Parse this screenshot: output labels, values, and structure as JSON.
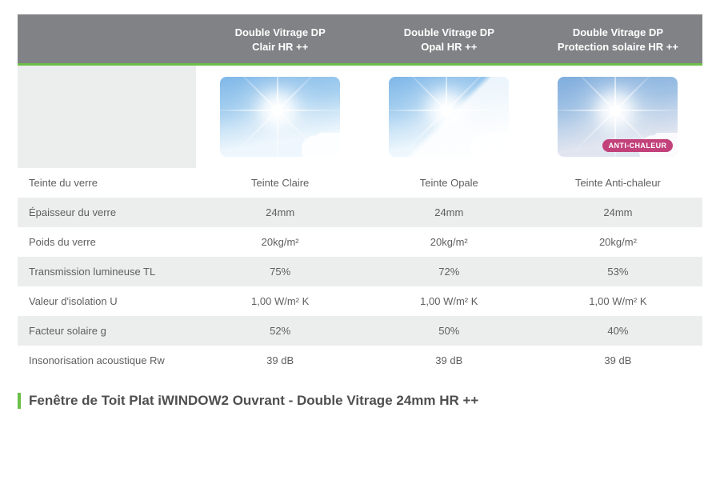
{
  "columns": [
    {
      "line1": "Double Vitrage DP",
      "line2": "Clair HR ++"
    },
    {
      "line1": "Double Vitrage DP",
      "line2": "Opal HR ++"
    },
    {
      "line1": "Double Vitrage DP",
      "line2": "Protection solaire HR ++"
    }
  ],
  "badge_anti_chaleur": "ANTI-CHALEUR",
  "rows": [
    {
      "label": "Teinte du verre",
      "values": [
        "Teinte Claire",
        "Teinte Opale",
        "Teinte Anti-chaleur"
      ]
    },
    {
      "label": "Épaisseur du verre",
      "values": [
        "24mm",
        "24mm",
        "24mm"
      ]
    },
    {
      "label": "Poids du verre",
      "values": [
        "20kg/m²",
        "20kg/m²",
        "20kg/m²"
      ]
    },
    {
      "label": "Transmission lumineuse TL",
      "values": [
        "75%",
        "72%",
        "53%"
      ]
    },
    {
      "label": "Valeur d'isolation U",
      "values": [
        "1,00 W/m² K",
        "1,00 W/m² K",
        "1,00 W/m² K"
      ]
    },
    {
      "label": "Facteur solaire g",
      "values": [
        "52%",
        "50%",
        "40%"
      ]
    },
    {
      "label": "Insonorisation acoustique Rw",
      "values": [
        "39 dB",
        "39 dB",
        "39 dB"
      ]
    }
  ],
  "footer_title": "Fenêtre de Toit Plat iWINDOW2 Ouvrant - Double Vitrage 24mm HR ++"
}
